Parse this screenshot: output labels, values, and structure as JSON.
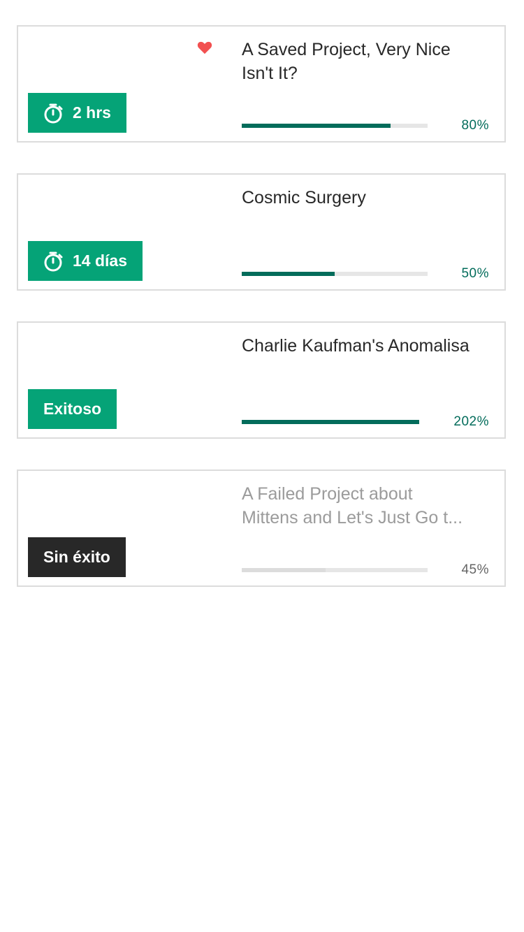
{
  "colors": {
    "accent_green": "#05a377",
    "progress_green": "#036c5b",
    "failed_badge": "#282828",
    "heart_red": "#f25050",
    "track_gray": "#e6e6e6",
    "failed_text": "#9b9b9b"
  },
  "projects": [
    {
      "title_line1": "A Saved Project, Very Nice",
      "title_line2": "Isn't It?",
      "saved": true,
      "saved_icon": "heart-icon",
      "badge_icon": "stopwatch-icon",
      "badge_label": "2 hrs",
      "progress": 0.8,
      "percent_label": "80%"
    },
    {
      "title_line1": "Cosmic Surgery",
      "title_line2": "",
      "saved": false,
      "badge_icon": "stopwatch-icon",
      "badge_label": "14 días",
      "progress": 0.5,
      "percent_label": "50%"
    },
    {
      "title_line1": "Charlie Kaufman's Anomalisa",
      "title_line2": "",
      "saved": false,
      "badge_label": "Exitoso",
      "progress": 1.0,
      "percent_label": "202%"
    },
    {
      "title_line1": "A Failed Project about",
      "title_line2": "Mittens and Let's Just Go t...",
      "saved": false,
      "badge_label": "Sin éxito",
      "progress": 0.45,
      "percent_label": "45%"
    }
  ]
}
